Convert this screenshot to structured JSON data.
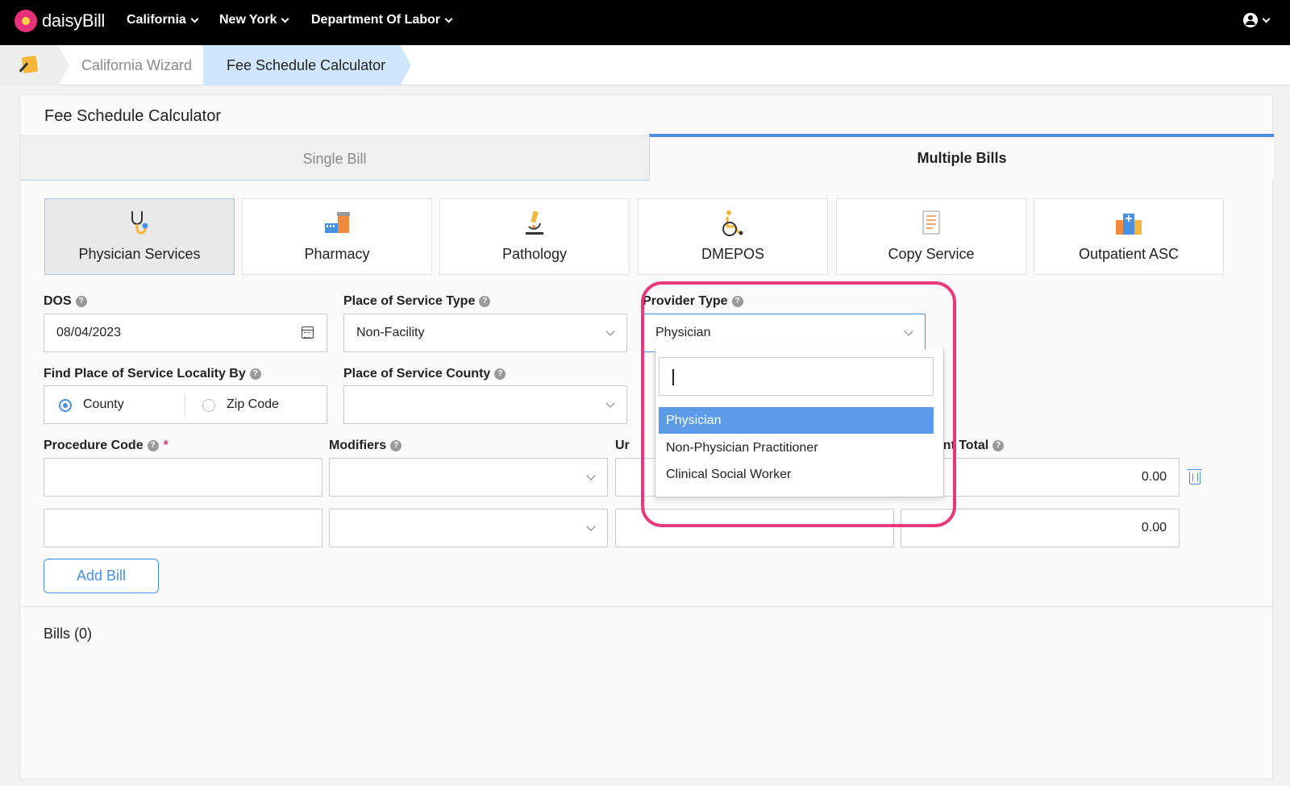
{
  "topnav": {
    "brand": "daisyBill",
    "menus": [
      "California",
      "New York",
      "Department Of Labor"
    ]
  },
  "breadcrumb": {
    "items": [
      "California Wizard",
      "Fee Schedule Calculator"
    ]
  },
  "card": {
    "title": "Fee Schedule Calculator",
    "tabs": [
      "Single Bill",
      "Multiple Bills"
    ],
    "active_tab": "Multiple Bills"
  },
  "services": [
    {
      "label": "Physician Services",
      "icon": "stethoscope-icon",
      "active": true
    },
    {
      "label": "Pharmacy",
      "icon": "pharmacy-icon",
      "active": false
    },
    {
      "label": "Pathology",
      "icon": "microscope-icon",
      "active": false
    },
    {
      "label": "DMEPOS",
      "icon": "wheelchair-icon",
      "active": false
    },
    {
      "label": "Copy Service",
      "icon": "document-icon",
      "active": false
    },
    {
      "label": "Outpatient ASC",
      "icon": "hospital-icon",
      "active": false
    }
  ],
  "form": {
    "dos": {
      "label": "DOS",
      "value": "08/04/2023"
    },
    "place_of_service_type": {
      "label": "Place of Service Type",
      "value": "Non-Facility"
    },
    "provider_type": {
      "label": "Provider Type",
      "value": "Physician"
    },
    "find_locality": {
      "label": "Find Place of Service Locality By",
      "options": [
        "County",
        "Zip Code"
      ],
      "selected": "County"
    },
    "county": {
      "label": "Place of Service County",
      "value": ""
    },
    "procedure_code": {
      "label": "Procedure Code",
      "required_mark": "*"
    },
    "modifiers": {
      "label": "Modifiers"
    },
    "units": {
      "label": "Units",
      "visible_fragment": "Ur"
    },
    "payment_total": {
      "label": "Payment Total",
      "visible_fragment": "nent Total"
    },
    "rows": [
      {
        "total": "0.00"
      },
      {
        "total": "0.00"
      }
    ],
    "add_bill": "Add Bill"
  },
  "provider_dropdown": {
    "search_value": "",
    "options": [
      "Physician",
      "Non-Physician Practitioner",
      "Clinical Social Worker"
    ],
    "highlighted": "Physician"
  },
  "bills": {
    "label": "Bills (0)"
  },
  "colors": {
    "accent": "#4a90e2",
    "highlight_ring": "#e63a7a",
    "selected_option": "#5b9ae6",
    "brand_pink": "#e6307a"
  }
}
